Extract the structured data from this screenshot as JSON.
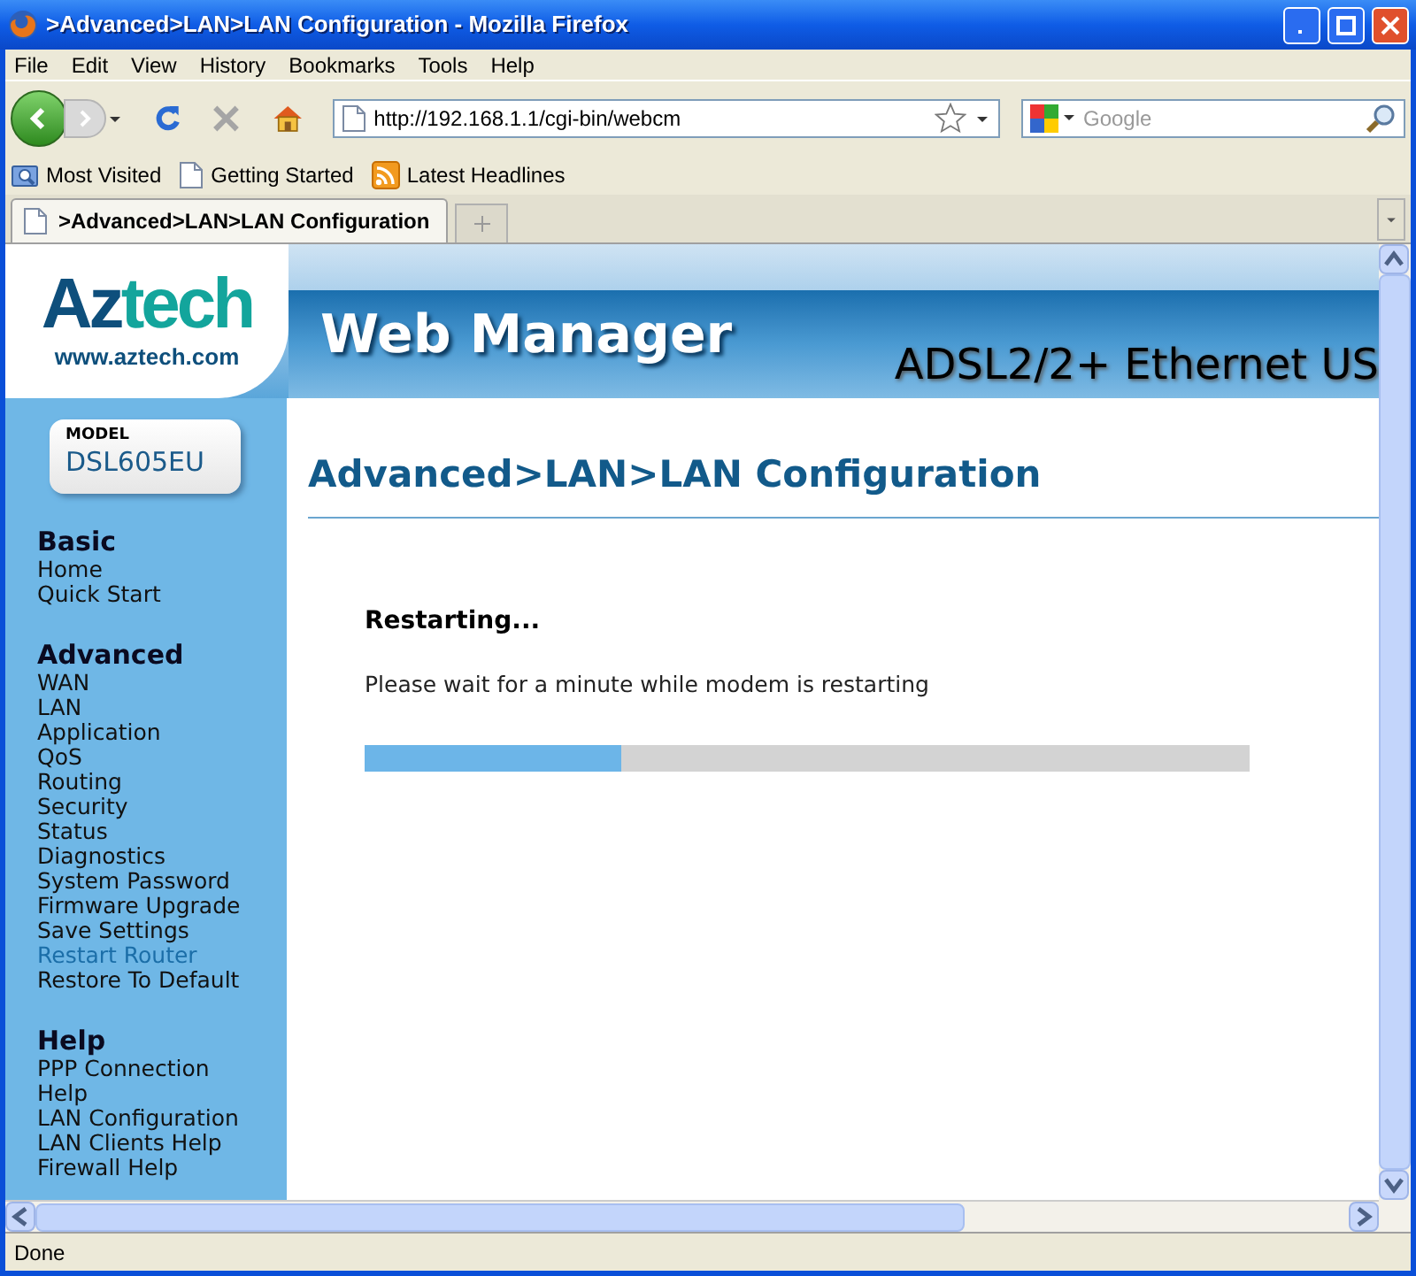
{
  "window": {
    "title": ">Advanced>LAN>LAN Configuration - Mozilla Firefox"
  },
  "menu": [
    "File",
    "Edit",
    "View",
    "History",
    "Bookmarks",
    "Tools",
    "Help"
  ],
  "address_bar": {
    "value": "http://192.168.1.1/cgi-bin/webcm"
  },
  "search": {
    "placeholder": "Google"
  },
  "bookmarks": [
    {
      "label": "Most Visited",
      "kind": "folder"
    },
    {
      "label": "Getting Started",
      "kind": "page"
    },
    {
      "label": "Latest Headlines",
      "kind": "feed"
    }
  ],
  "tabs": [
    {
      "label": ">Advanced>LAN>LAN Configuration",
      "selected": true
    }
  ],
  "page": {
    "logo": {
      "name": "Aztech",
      "url": "www.aztech.com"
    },
    "banner": {
      "title": "Web Manager",
      "product": "ADSL2/2+ Ethernet US"
    },
    "model": {
      "label": "MODEL",
      "name": "DSL605EU"
    },
    "sidebar": [
      {
        "heading": "Basic",
        "items": [
          {
            "label": "Home",
            "selected": false
          },
          {
            "label": "Quick Start",
            "selected": false
          }
        ]
      },
      {
        "heading": "Advanced",
        "items": [
          {
            "label": "WAN",
            "selected": false
          },
          {
            "label": "LAN",
            "selected": false
          },
          {
            "label": "Application",
            "selected": false
          },
          {
            "label": "QoS",
            "selected": false
          },
          {
            "label": "Routing",
            "selected": false
          },
          {
            "label": "Security",
            "selected": false
          },
          {
            "label": "Status",
            "selected": false
          },
          {
            "label": "Diagnostics",
            "selected": false
          },
          {
            "label": "System Password",
            "selected": false
          },
          {
            "label": "Firmware Upgrade",
            "selected": false
          },
          {
            "label": "Save Settings",
            "selected": false
          },
          {
            "label": "Restart Router",
            "selected": true
          },
          {
            "label": "Restore To Default",
            "selected": false
          }
        ]
      },
      {
        "heading": "Help",
        "items": [
          {
            "label": "PPP Connection",
            "selected": false
          },
          {
            "label": "Help",
            "selected": false
          },
          {
            "label": "LAN Configuration",
            "selected": false
          },
          {
            "label": "LAN Clients Help",
            "selected": false
          },
          {
            "label": "Firewall Help",
            "selected": false
          }
        ]
      }
    ],
    "heading": "Advanced>LAN>LAN Configuration",
    "status_title": "Restarting...",
    "message": "Please wait for a minute while modem is restarting",
    "progress": {
      "level": 0.29
    }
  },
  "status_bar": {
    "text": "Done"
  }
}
